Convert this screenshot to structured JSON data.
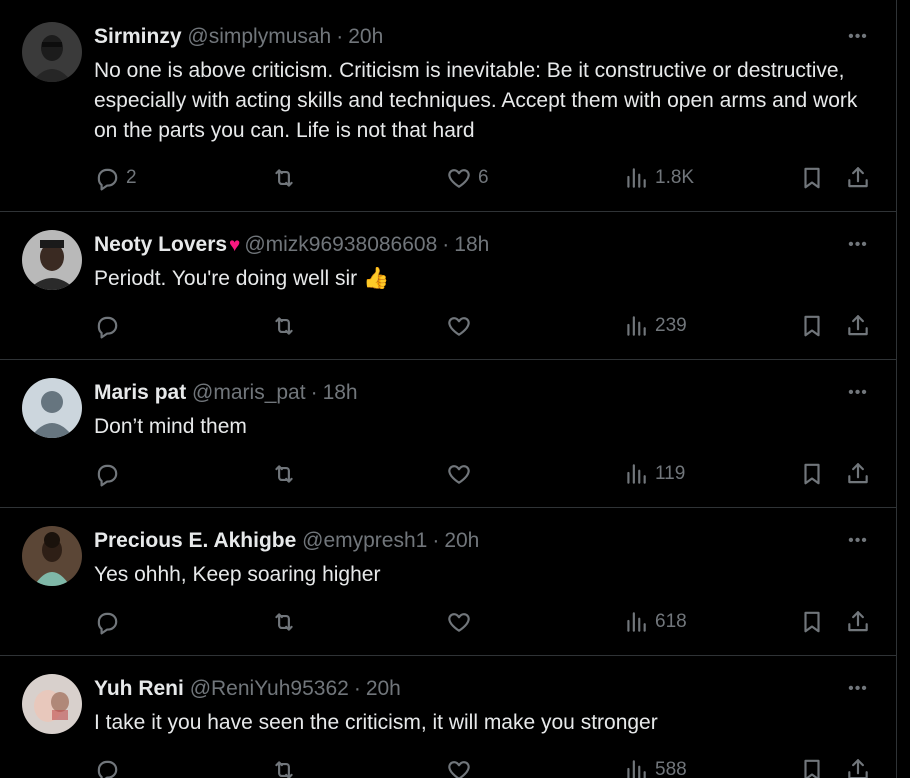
{
  "tweets": [
    {
      "display_name": "Sirminzy",
      "handle": "@simplymusah",
      "separator": "·",
      "time": "20h",
      "text": "No one is above criticism. Criticism is inevitable: Be it constructive or destructive, especially with acting skills and techniques. Accept them with open arms and work on the parts you can. Life is not that hard",
      "replies": "2",
      "retweets": "",
      "likes": "6",
      "views": "1.8K"
    },
    {
      "display_name": "Neoty Lovers",
      "name_emoji": "♥",
      "handle": "@mizk96938086608",
      "separator": "·",
      "time": "18h",
      "text": "Periodt. You're doing well sir 👍",
      "replies": "",
      "retweets": "",
      "likes": "",
      "views": "239"
    },
    {
      "display_name": "Maris pat",
      "handle": "@maris_pat",
      "separator": "·",
      "time": "18h",
      "text": "Don’t mind them",
      "replies": "",
      "retweets": "",
      "likes": "",
      "views": "119"
    },
    {
      "display_name": "Precious E. Akhigbe",
      "handle": "@emypresh1",
      "separator": "·",
      "time": "20h",
      "text": "Yes ohhh, Keep soaring higher",
      "replies": "",
      "retweets": "",
      "likes": "",
      "views": "618"
    },
    {
      "display_name": "Yuh Reni",
      "handle": "@ReniYuh95362",
      "separator": "·",
      "time": "20h",
      "text": "I take it you have seen the criticism, it will make you stronger",
      "replies": "",
      "retweets": "",
      "likes": "",
      "views": "588"
    }
  ],
  "icons": {
    "more": "more-horizontal-icon",
    "reply": "reply-bubble-icon",
    "retweet": "retweet-arrows-icon",
    "like": "heart-outline-icon",
    "views": "bar-chart-views-icon",
    "bookmark": "bookmark-icon",
    "share": "share-upload-icon"
  },
  "colors": {
    "background": "#000000",
    "text_primary": "#e7e9ea",
    "text_secondary": "#71767b",
    "divider": "#2f3336",
    "heart_emoji": "#f91880"
  }
}
